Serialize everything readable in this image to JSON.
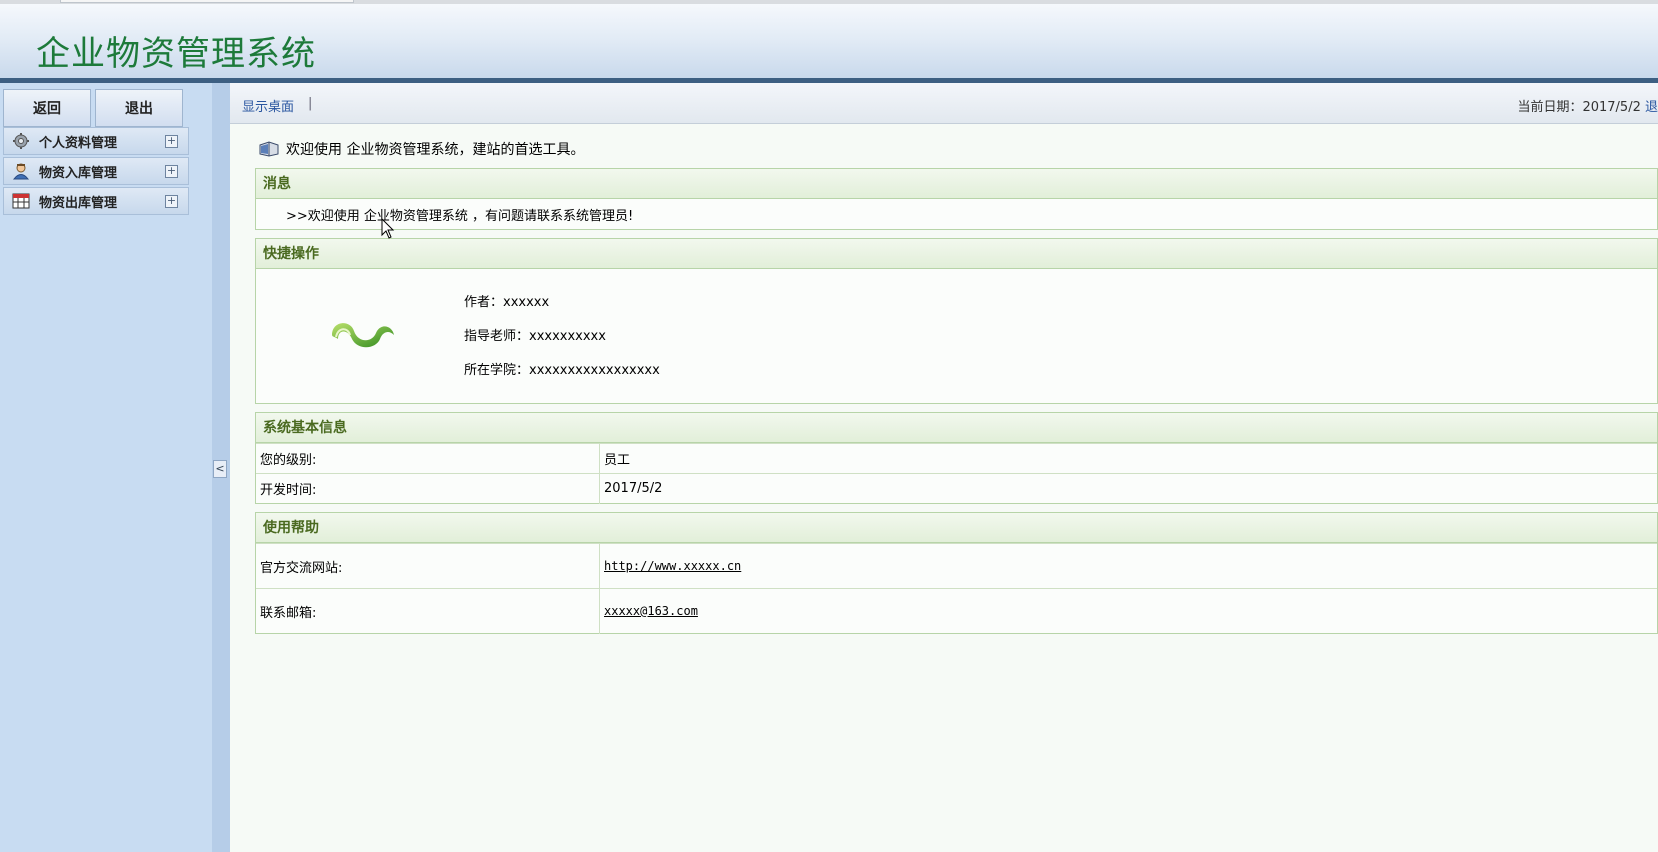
{
  "app": {
    "title": "企业物资管理系统"
  },
  "sidebar": {
    "back_label": "返回",
    "exit_label": "退出",
    "items": [
      {
        "label": "个人资料管理",
        "icon": "gear-icon"
      },
      {
        "label": "物资入库管理",
        "icon": "user-icon"
      },
      {
        "label": "物资出库管理",
        "icon": "table-icon"
      }
    ],
    "expand_symbol": "+",
    "collapse_symbol": "<"
  },
  "toolbar": {
    "desktop_link": "显示桌面",
    "separator": "|",
    "date_text": "当前日期：2017/5/2",
    "date_link_fragment": "退"
  },
  "welcome": {
    "text": "欢迎使用 企业物资管理系统，建站的首选工具。"
  },
  "messages": {
    "heading": "消息",
    "text": ">>欢迎使用 企业物资管理系统 ，有问题请联系系统管理员!"
  },
  "quick": {
    "heading": "快捷操作",
    "author": "作者：xxxxxx",
    "teacher": "指导老师：xxxxxxxxxx",
    "college": "所在学院：xxxxxxxxxxxxxxxxx"
  },
  "system_info": {
    "heading": "系统基本信息",
    "rows": [
      {
        "key": "您的级别:",
        "value": "员工"
      },
      {
        "key": "开发时间:",
        "value": "2017/5/2"
      }
    ]
  },
  "help": {
    "heading": "使用帮助",
    "rows": [
      {
        "key": "官方交流网站:",
        "value": "http://www.xxxxx.cn"
      },
      {
        "key": "联系邮箱:",
        "value": "xxxxx@163.com"
      }
    ]
  },
  "colors": {
    "title_green": "#1d7a3a",
    "header_bar": "#3d5f82",
    "sidebar_bg": "#c8dcf2",
    "panel_head_text": "#4a6a20",
    "link_blue": "#2a56a0"
  }
}
